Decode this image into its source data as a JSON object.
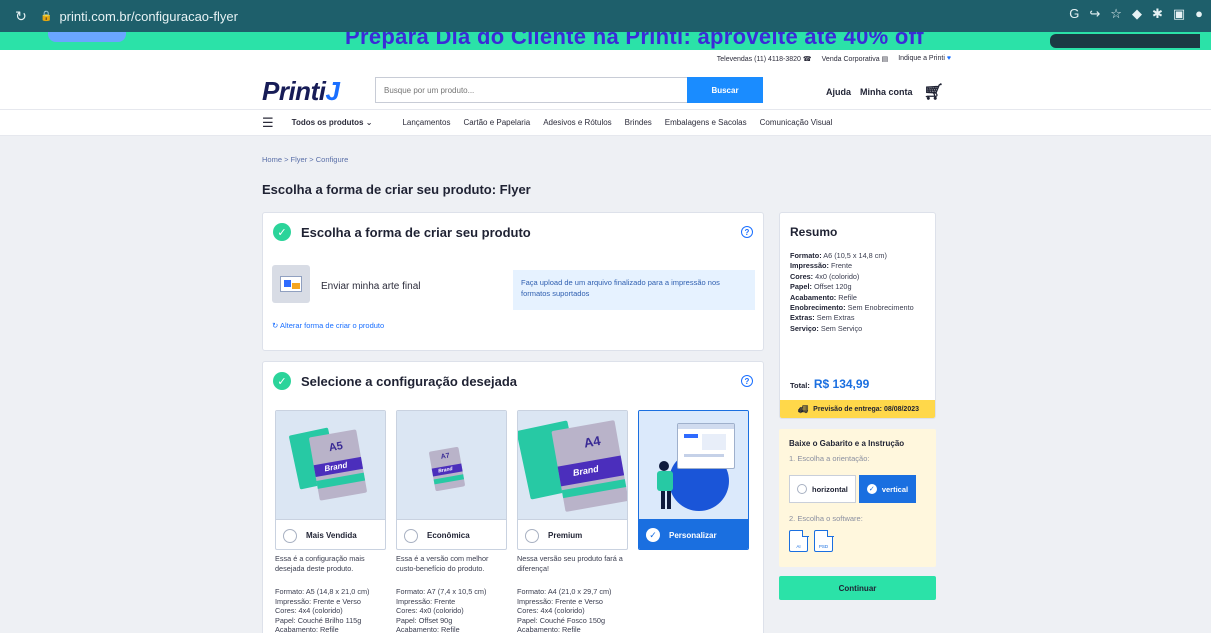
{
  "browser": {
    "url": "printi.com.br/configuracao-flyer",
    "reload_icon": "reload-icon",
    "lock_icon": "lock-icon"
  },
  "promo": {
    "text": "Prepara Dia do Cliente na Printi: aproveite até 40% off"
  },
  "utility": {
    "televendas": "Televendas (11) 4118-3820",
    "venda_corporativa": "Venda Corporativa",
    "indique": "Indique a Printi"
  },
  "header": {
    "logo": "Printi",
    "logo_mark": "J",
    "search_placeholder": "Busque por um produto...",
    "search_button": "Buscar",
    "help": "Ajuda",
    "account": "Minha conta"
  },
  "nav": {
    "all_products": "Todos os produtos",
    "items": [
      "Lançamentos",
      "Cartão e Papelaria",
      "Adesivos e Rótulos",
      "Brindes",
      "Embalagens e Sacolas",
      "Comunicação Visual"
    ]
  },
  "breadcrumb": "Home  >  Flyer  >  Configure",
  "page_title": "Escolha a forma de criar seu produto: Flyer",
  "step1": {
    "title": "Escolha a forma de criar seu produto",
    "art_label": "Enviar minha arte final",
    "art_info": "Faça upload de um arquivo finalizado para a impressão nos formatos suportados",
    "change_link": "Alterar forma de criar o produto"
  },
  "step2": {
    "title": "Selecione a configuração desejada",
    "options": [
      {
        "label": "Mais Vendida",
        "size_tag": "A5",
        "brand": "Brand",
        "description": "Essa é a configuração mais desejada deste produto.",
        "spec": [
          "Formato: A5 (14,8 x 21,0 cm)",
          "Impressão: Frente e Verso",
          "Cores: 4x4 (colorido)",
          "Papel: Couché Brilho 115g",
          "Acabamento: Refile"
        ]
      },
      {
        "label": "Econômica",
        "size_tag": "A7",
        "brand": "Brand",
        "description": "Essa é a versão com melhor custo-benefício do produto.",
        "spec": [
          "Formato: A7 (7,4 x 10,5 cm)",
          "Impressão: Frente",
          "Cores: 4x0 (colorido)",
          "Papel: Offset 90g",
          "Acabamento: Refile"
        ]
      },
      {
        "label": "Premium",
        "size_tag": "A4",
        "brand": "Brand",
        "description": "Nessa versão seu produto fará a diferença!",
        "spec": [
          "Formato: A4 (21,0 x 29,7 cm)",
          "Impressão: Frente e Verso",
          "Cores: 4x4 (colorido)",
          "Papel: Couché Fosco 150g",
          "Acabamento: Refile"
        ]
      },
      {
        "label": "Personalizar",
        "selected": true
      }
    ]
  },
  "summary": {
    "title": "Resumo",
    "lines": [
      {
        "k": "Formato:",
        "v": "A6 (10,5 x 14,8 cm)"
      },
      {
        "k": "Impressão:",
        "v": "Frente"
      },
      {
        "k": "Cores:",
        "v": "4x0 (colorido)"
      },
      {
        "k": "Papel:",
        "v": "Offset 120g"
      },
      {
        "k": "Acabamento:",
        "v": "Refile"
      },
      {
        "k": "Enobrecimento:",
        "v": "Sem Enobrecimento"
      },
      {
        "k": "Extras:",
        "v": "Sem Extras"
      },
      {
        "k": "Serviço:",
        "v": "Sem Serviço"
      }
    ],
    "total_label": "Total:",
    "total_value": "R$ 134,99",
    "delivery": "Previsão de entrega: 08/08/2023"
  },
  "gabarito": {
    "title": "Baixe o Gabarito e a Instrução",
    "step1": "1. Escolha a orientação:",
    "horizontal": "horizontal",
    "vertical": "vertical",
    "step2": "2. Escolha o software:",
    "software": [
      "AI",
      "PSD"
    ]
  },
  "continue_label": "Continuar",
  "colors": {
    "brand_blue": "#1a6fe0",
    "accent_green": "#2be2a8",
    "success_green": "#2bd49a",
    "delivery_yellow": "#ffd84a"
  }
}
